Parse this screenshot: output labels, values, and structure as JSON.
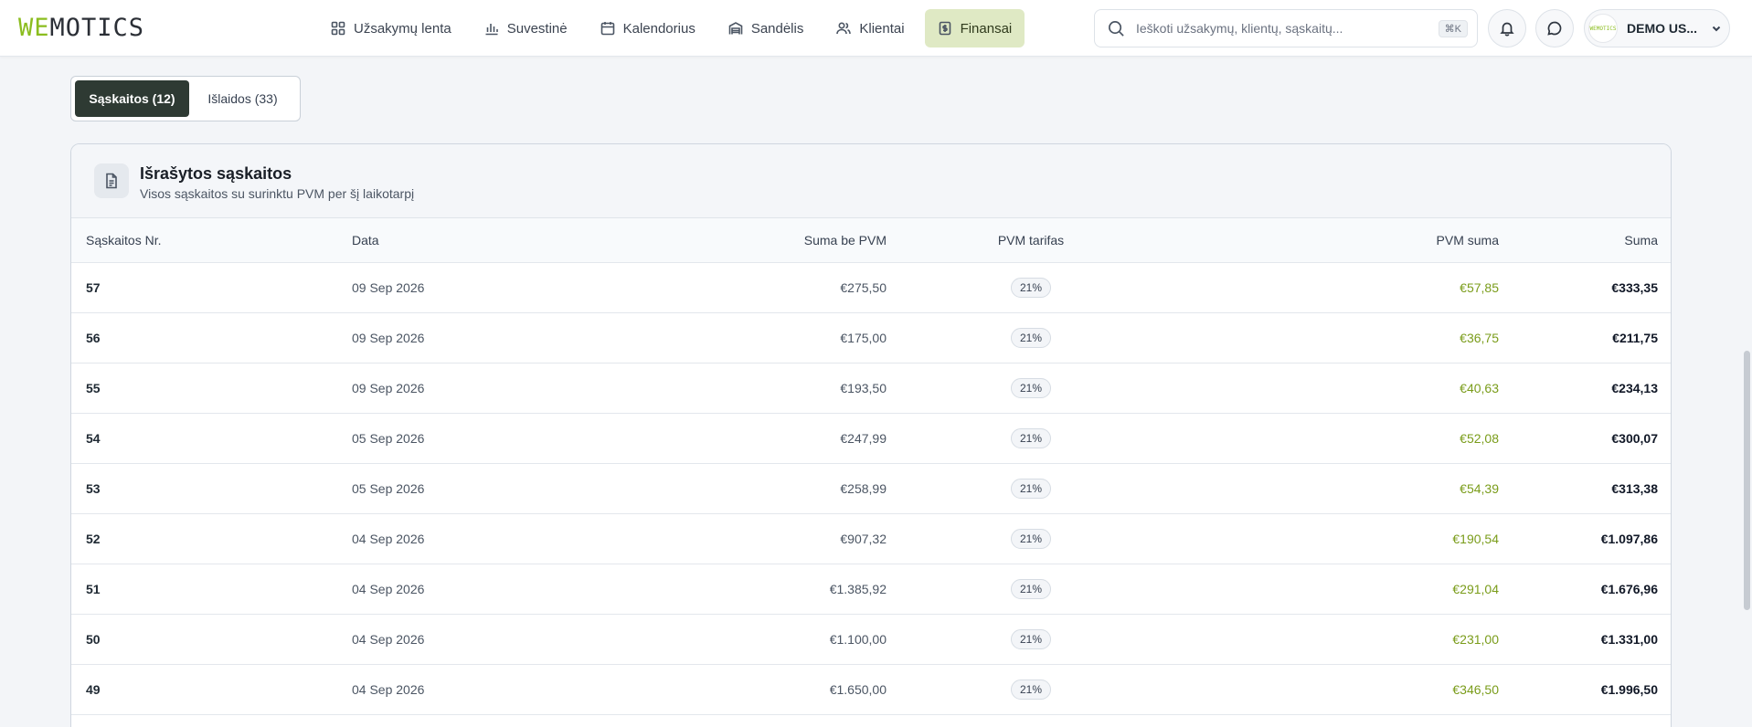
{
  "brand": {
    "logo_accent": "WE",
    "logo_rest": "MOTICS",
    "accent_color": "#8bbd1f"
  },
  "nav": [
    {
      "label": "Užsakymų lenta",
      "icon": "grid-icon"
    },
    {
      "label": "Suvestinė",
      "icon": "bar-chart-icon"
    },
    {
      "label": "Kalendorius",
      "icon": "calendar-icon"
    },
    {
      "label": "Sandėlis",
      "icon": "warehouse-icon"
    },
    {
      "label": "Klientai",
      "icon": "users-icon"
    },
    {
      "label": "Finansai",
      "icon": "receipt-icon",
      "active": true
    }
  ],
  "search": {
    "placeholder": "Ieškoti užsakymų, klientų, sąskaitų...",
    "shortcut": "⌘K"
  },
  "user": {
    "name": "DEMO US...",
    "avatar_text": "WEMOTICS"
  },
  "tabs": {
    "invoices": "Sąskaitos (12)",
    "expenses": "Išlaidos (33)"
  },
  "card": {
    "title": "Išrašytos sąskaitos",
    "subtitle": "Visos sąskaitos su surinktu PVM per šį laikotarpį"
  },
  "table": {
    "headers": {
      "number": "Sąskaitos Nr.",
      "date": "Data",
      "net": "Suma be PVM",
      "rate": "PVM tarifas",
      "vat": "PVM suma",
      "total": "Suma"
    },
    "rows": [
      {
        "number": "57",
        "date": "09 Sep 2026",
        "net": "€275,50",
        "rate": "21%",
        "vat": "€57,85",
        "total": "€333,35"
      },
      {
        "number": "56",
        "date": "09 Sep 2026",
        "net": "€175,00",
        "rate": "21%",
        "vat": "€36,75",
        "total": "€211,75"
      },
      {
        "number": "55",
        "date": "09 Sep 2026",
        "net": "€193,50",
        "rate": "21%",
        "vat": "€40,63",
        "total": "€234,13"
      },
      {
        "number": "54",
        "date": "05 Sep 2026",
        "net": "€247,99",
        "rate": "21%",
        "vat": "€52,08",
        "total": "€300,07"
      },
      {
        "number": "53",
        "date": "05 Sep 2026",
        "net": "€258,99",
        "rate": "21%",
        "vat": "€54,39",
        "total": "€313,38"
      },
      {
        "number": "52",
        "date": "04 Sep 2026",
        "net": "€907,32",
        "rate": "21%",
        "vat": "€190,54",
        "total": "€1.097,86"
      },
      {
        "number": "51",
        "date": "04 Sep 2026",
        "net": "€1.385,92",
        "rate": "21%",
        "vat": "€291,04",
        "total": "€1.676,96"
      },
      {
        "number": "50",
        "date": "04 Sep 2026",
        "net": "€1.100,00",
        "rate": "21%",
        "vat": "€231,00",
        "total": "€1.331,00"
      },
      {
        "number": "49",
        "date": "04 Sep 2026",
        "net": "€1.650,00",
        "rate": "21%",
        "vat": "€346,50",
        "total": "€1.996,50"
      }
    ]
  }
}
